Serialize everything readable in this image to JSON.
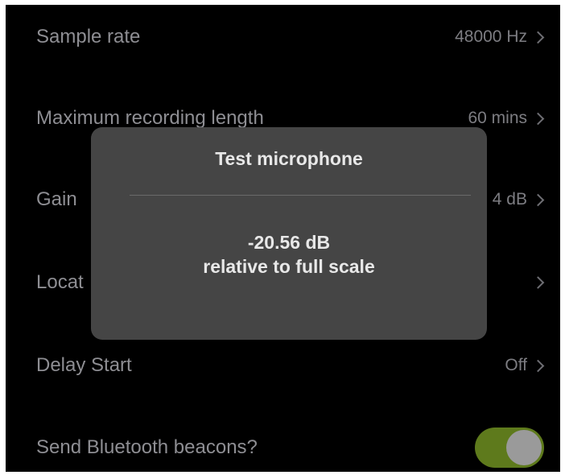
{
  "settings": {
    "rows": [
      {
        "label": "Sample rate",
        "value": "48000 Hz"
      },
      {
        "label": "Maximum recording length",
        "value": "60 mins"
      },
      {
        "label": "Gain",
        "value": "4 dB"
      },
      {
        "label": "Locat",
        "value": ""
      },
      {
        "label": "Delay Start",
        "value": "Off"
      },
      {
        "label": "Send Bluetooth beacons?",
        "toggle_on": true
      }
    ]
  },
  "alert": {
    "title": "Test microphone",
    "level": "-20.56 dB",
    "caption": "relative to full scale"
  },
  "colors": {
    "background": "#000000",
    "label": "#8e8e93",
    "alert_bg": "#4a4a4a",
    "toggle_on": "#5e7a1c"
  },
  "icons": {
    "row_chevron": "chevron-right-icon"
  }
}
